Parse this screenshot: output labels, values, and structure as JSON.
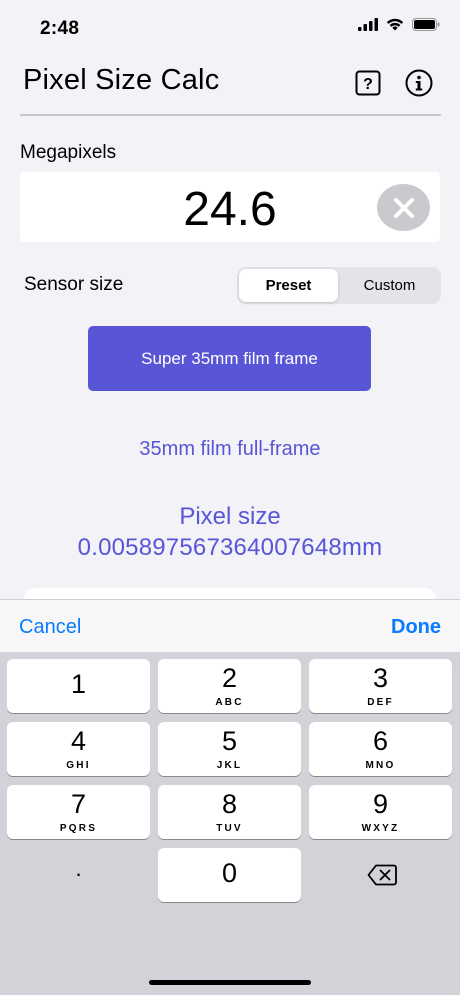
{
  "status": {
    "time": "2:48"
  },
  "header": {
    "title": "Pixel Size Calc"
  },
  "megapixels": {
    "label": "Megapixels",
    "value": "24.6"
  },
  "sensor": {
    "label": "Sensor size",
    "segments": [
      "Preset",
      "Custom"
    ],
    "selected": "Preset",
    "preset_button": "Super 35mm film frame",
    "alt_preset": "35mm film full-frame"
  },
  "result": {
    "title": "Pixel size",
    "value": "0.005897567364007648mm"
  },
  "toolbar": {
    "cancel": "Cancel",
    "done": "Done"
  },
  "keypad": {
    "keys": [
      {
        "num": "1",
        "letters": ""
      },
      {
        "num": "2",
        "letters": "ABC"
      },
      {
        "num": "3",
        "letters": "DEF"
      },
      {
        "num": "4",
        "letters": "GHI"
      },
      {
        "num": "5",
        "letters": "JKL"
      },
      {
        "num": "6",
        "letters": "MNO"
      },
      {
        "num": "7",
        "letters": "PQRS"
      },
      {
        "num": "8",
        "letters": "TUV"
      },
      {
        "num": "9",
        "letters": "WXYZ"
      },
      {
        "num": "0",
        "letters": ""
      }
    ],
    "decimal": ".",
    "delete_icon": "backspace-icon"
  },
  "colors": {
    "accent": "#5856d6",
    "link": "#0a7aff",
    "background": "#f2f2f7",
    "keypad_bg": "#d1d3d9"
  }
}
